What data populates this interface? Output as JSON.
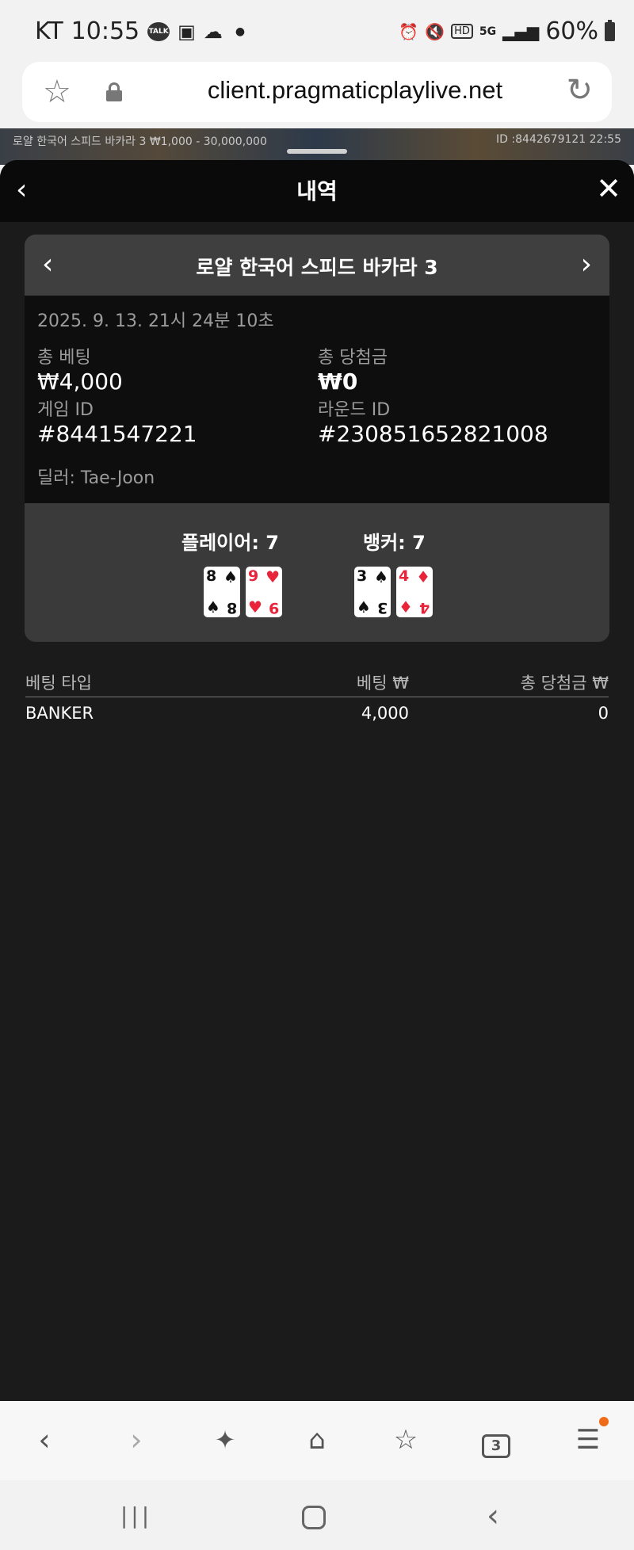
{
  "status_bar": {
    "carrier": "KT",
    "time": "10:55",
    "talk_label": "TALK",
    "hd_label": "HD",
    "network": "5G",
    "battery": "60%"
  },
  "browser": {
    "url": "client.pragmaticplaylive.net"
  },
  "game_strip": {
    "title": "로얄 한국어 스피드 바카라 3 ₩1,000 - 30,000,000",
    "id_time": "ID :8442679121 22:55"
  },
  "history": {
    "title": "내역",
    "game_name": "로얄 한국어 스피드 바카라 3",
    "datetime": "2025. 9. 13. 21시 24분 10초",
    "total_bet_label": "총 베팅",
    "total_bet_value": "₩4,000",
    "total_win_label": "총 당첨금",
    "total_win_value": "₩0",
    "game_id_label": "게임 ID",
    "game_id_value": "#8441547221",
    "round_id_label": "라운드 ID",
    "round_id_value": "#230851652821008",
    "dealer": "딜러: Tae-Joon",
    "player_label": "플레이어: 7",
    "banker_label": "뱅커: 7",
    "player_cards": [
      {
        "rank": "8",
        "suit": "♠",
        "color": "#111111"
      },
      {
        "rank": "9",
        "suit": "♥",
        "color": "#e8233a"
      }
    ],
    "banker_cards": [
      {
        "rank": "3",
        "suit": "♠",
        "color": "#111111"
      },
      {
        "rank": "4",
        "suit": "♦",
        "color": "#e8233a"
      }
    ],
    "bets_table": {
      "headers": [
        "베팅 타입",
        "베팅 ₩",
        "총 당첨금 ₩"
      ],
      "rows": [
        [
          "BANKER",
          "4,000",
          "0"
        ]
      ]
    }
  },
  "tabs_count": "3"
}
